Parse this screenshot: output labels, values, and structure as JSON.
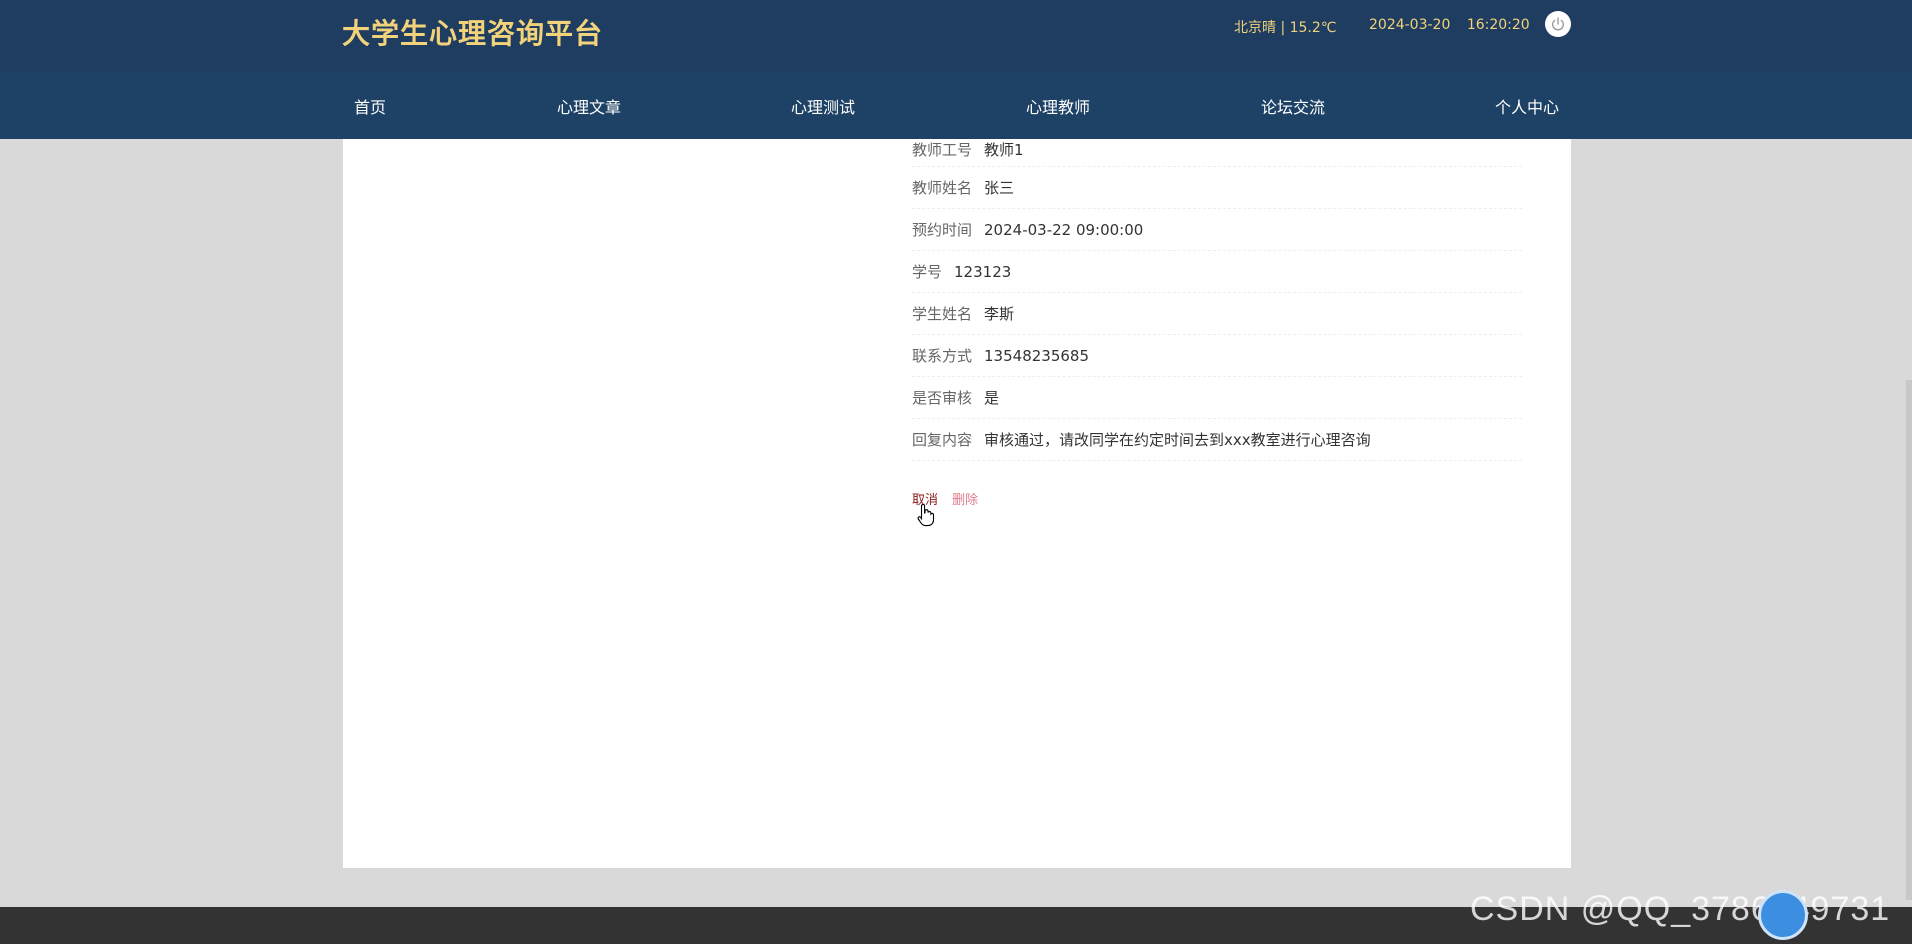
{
  "header": {
    "site_title": "大学生心理咨询平台",
    "weather": "北京晴 | 15.2℃",
    "date": "2024-03-20",
    "time": "16:20:20",
    "power_icon": "power-icon"
  },
  "nav": {
    "items": [
      {
        "label": "首页"
      },
      {
        "label": "心理文章"
      },
      {
        "label": "心理测试"
      },
      {
        "label": "心理教师"
      },
      {
        "label": "论坛交流"
      },
      {
        "label": "个人中心"
      }
    ]
  },
  "details": [
    {
      "label": "教师工号",
      "value": "教师1"
    },
    {
      "label": "教师姓名",
      "value": "张三"
    },
    {
      "label": "预约时间",
      "value": "2024-03-22 09:00:00"
    },
    {
      "label": "学号",
      "value": "123123"
    },
    {
      "label": "学生姓名",
      "value": "李斯"
    },
    {
      "label": "联系方式",
      "value": "13548235685"
    },
    {
      "label": "是否审核",
      "value": "是"
    },
    {
      "label": "回复内容",
      "value": "审核通过，请改同学在约定时间去到xxx教室进行心理咨询"
    }
  ],
  "actions": {
    "cancel_label": "取消",
    "delete_label": "删除"
  },
  "watermark": "CSDN @QQ_3786649731",
  "colors": {
    "header_bg": "#1e3d61",
    "nav_bg": "#1d4266",
    "title_color": "#f2d27a",
    "cancel_color": "#8b1a1a",
    "delete_color": "#e07b8a"
  }
}
